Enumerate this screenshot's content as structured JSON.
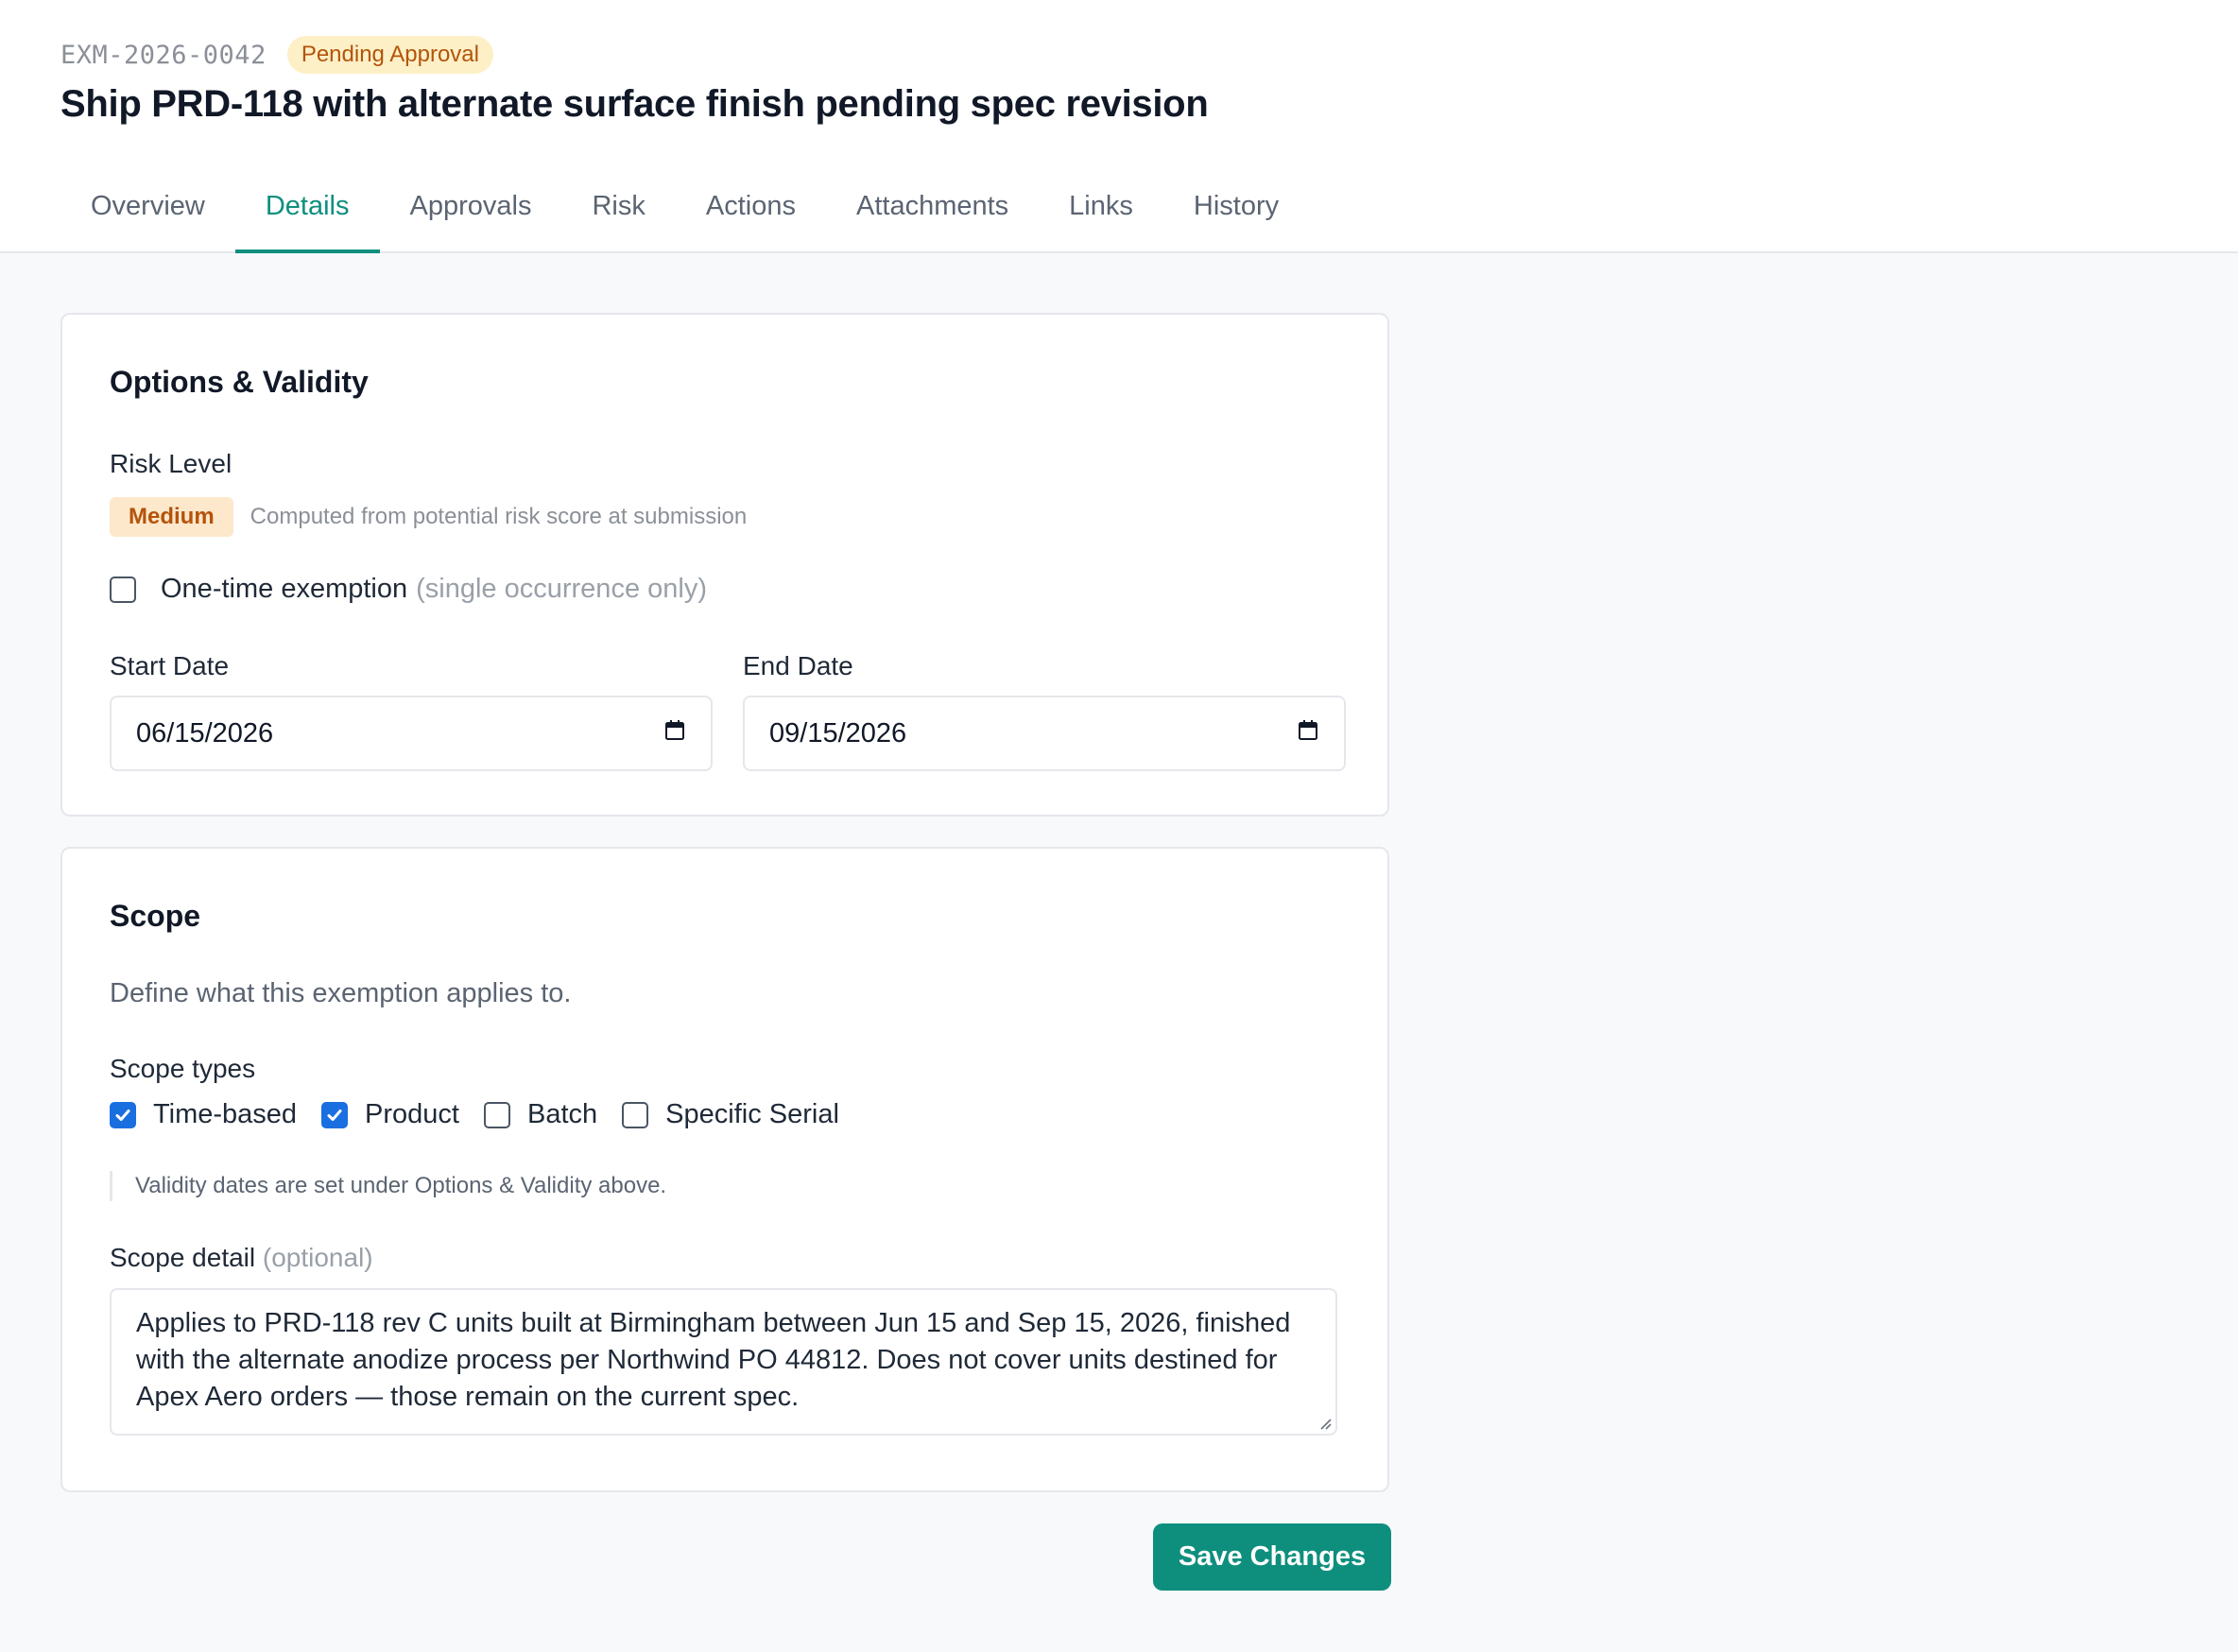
{
  "header": {
    "exemption_id": "EXM-2026-0042",
    "status": "Pending Approval",
    "title": "Ship PRD-118 with alternate surface finish pending spec revision"
  },
  "tabs": [
    {
      "label": "Overview",
      "active": false
    },
    {
      "label": "Details",
      "active": true
    },
    {
      "label": "Approvals",
      "active": false
    },
    {
      "label": "Risk",
      "active": false
    },
    {
      "label": "Actions",
      "active": false
    },
    {
      "label": "Attachments",
      "active": false
    },
    {
      "label": "Links",
      "active": false
    },
    {
      "label": "History",
      "active": false
    }
  ],
  "options": {
    "title": "Options & Validity",
    "risk_label": "Risk Level",
    "risk_value": "Medium",
    "risk_note": "Computed from potential risk score at submission",
    "one_time_label": "One-time exemption",
    "one_time_hint": "(single occurrence only)",
    "one_time_checked": false,
    "start_label": "Start Date",
    "start_value": "06/15/2026",
    "end_label": "End Date",
    "end_value": "09/15/2026"
  },
  "scope": {
    "title": "Scope",
    "description": "Define what this exemption applies to.",
    "types_label": "Scope types",
    "types": [
      {
        "label": "Time-based",
        "checked": true
      },
      {
        "label": "Product",
        "checked": true
      },
      {
        "label": "Batch",
        "checked": false
      },
      {
        "label": "Specific Serial",
        "checked": false
      }
    ],
    "note": "Validity dates are set under Options & Validity above.",
    "detail_label": "Scope detail",
    "detail_optional": "(optional)",
    "detail_value": "Applies to PRD-118 rev C units built at Birmingham between Jun 15 and Sep 15, 2026, finished with the alternate anodize process per Northwind PO 44812. Does not cover units destined for Apex Aero orders — those remain on the current spec."
  },
  "actions": {
    "save_label": "Save Changes"
  },
  "colors": {
    "accent": "#0e8f7e",
    "checkbox_checked": "#1a6fe0",
    "status_badge_bg": "#fdf0c7",
    "status_badge_text": "#b4540a"
  },
  "icons": {
    "date_picker": "calendar-icon",
    "checked": "checkmark-icon"
  }
}
